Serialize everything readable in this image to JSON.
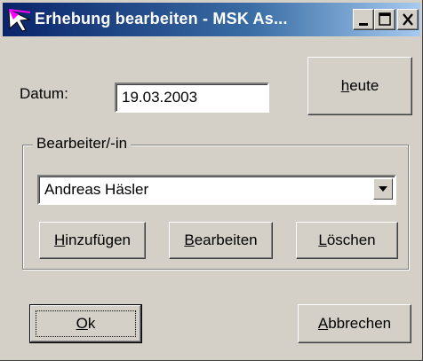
{
  "window": {
    "title": "Erhebung bearbeiten - MSK As...",
    "title_bar_color": "#0a246a"
  },
  "form": {
    "datum_label": "Datum:",
    "datum_value": "19.03.2003",
    "heute_button": "heute"
  },
  "bearbeiter": {
    "group_title": "Bearbeiter/-in",
    "selected": "Andreas Häsler",
    "add_button": "Hinzufügen",
    "edit_button": "Bearbeiten",
    "delete_button": "Löschen"
  },
  "footer": {
    "ok_button": "Ok",
    "cancel_button": "Abbrechen"
  },
  "icons": {
    "app": "app-icon",
    "minimize": "minimize-icon",
    "maximize": "maximize-icon",
    "close": "close-icon",
    "dropdown": "chevron-down-icon"
  }
}
